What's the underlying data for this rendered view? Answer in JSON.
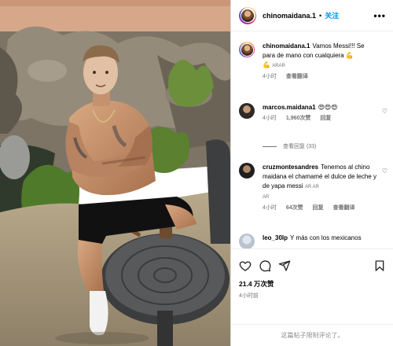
{
  "post": {
    "username": "chinomaidana.1",
    "follow_label": "关注",
    "more_label": "•••",
    "caption": {
      "username": "chinomaidana.1",
      "text": "Vamos Messi!!! Se para de mano con cualquiera",
      "emoji": "💪",
      "lang_tag": "ARAR",
      "time": "4小时",
      "translate_label": "查看翻译"
    },
    "comments": [
      {
        "username": "marcos.maidana1",
        "text": "😍😍😍",
        "time": "4小时",
        "likes": "1,960次赞",
        "reply_label": "回复",
        "view_replies": "查看回复 (33)"
      },
      {
        "username": "cruzmontesandres",
        "text": "Tenemos al chino maidana el chamamé el dulce de leche y de yapa messi",
        "lang_tag": "AR AR",
        "lang_tag_2": "AR",
        "time": "4小时",
        "likes": "64次赞",
        "reply_label": "回复",
        "translate_label": "查看翻译"
      },
      {
        "username": "leo_30lp",
        "text": "Y más con los mexicanos"
      }
    ],
    "like_count": "21.4 万次赞",
    "posted_ago": "4小时前",
    "footer_note": "这篇帖子限制评论了。"
  },
  "colors": {
    "accent": "#0095f6",
    "muted": "#737373",
    "heart": "#ed4956"
  }
}
